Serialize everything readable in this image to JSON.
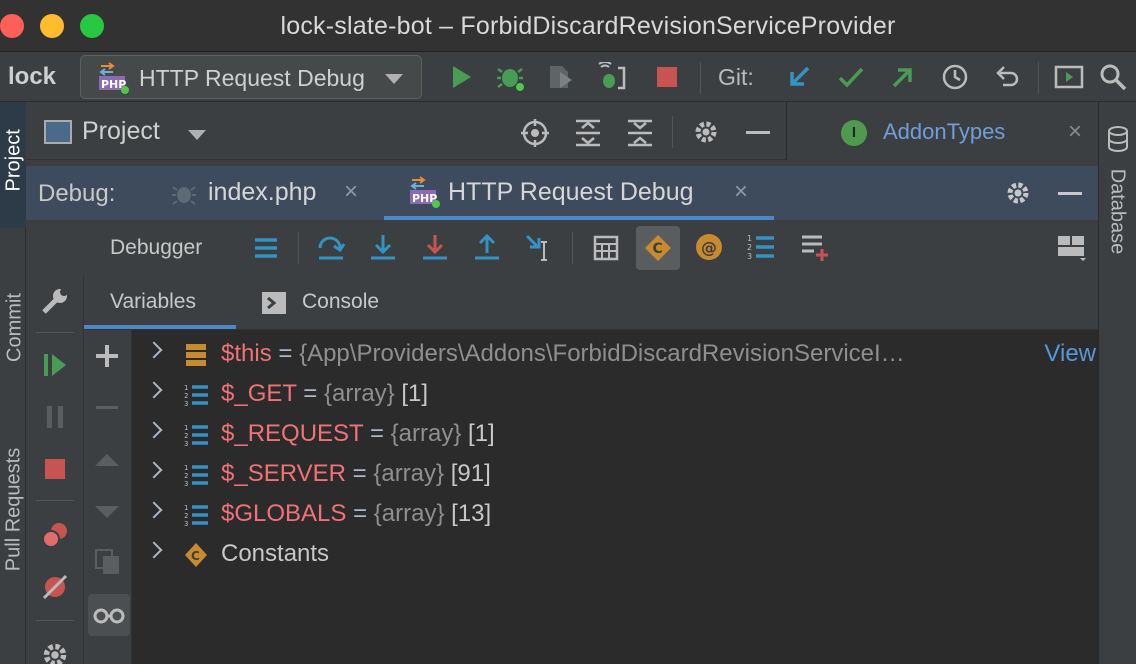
{
  "window": {
    "title": "lock-slate-bot – ForbidDiscardRevisionServiceProvider"
  },
  "toolbar": {
    "project_short": "lock",
    "run_config": "HTTP Request Debug",
    "git_label": "Git:"
  },
  "left_stripe": {
    "project": "Project",
    "commit": "Commit",
    "pull_requests": "Pull Requests"
  },
  "right_stripe": {
    "database": "Database"
  },
  "project_panel": {
    "label": "Project"
  },
  "editor_tab": {
    "badge": "I",
    "label": "AddonTypes",
    "close": "×"
  },
  "debug": {
    "label": "Debug:",
    "tabs": [
      {
        "label": "index.php",
        "close": "×"
      },
      {
        "label": "HTTP Request Debug",
        "close": "×"
      }
    ],
    "debugger_label": "Debugger",
    "subtabs": {
      "variables": "Variables",
      "console": "Console"
    }
  },
  "variables": [
    {
      "name": "$this",
      "eq": " = ",
      "type": "{App\\Providers\\Addons\\ForbidDiscardRevisionServiceI…",
      "count": "",
      "link": "View",
      "icon": "object-icon"
    },
    {
      "name": "$_GET",
      "eq": " = ",
      "type": "{array}",
      "count": " [1]",
      "icon": "array-icon"
    },
    {
      "name": "$_REQUEST",
      "eq": " = ",
      "type": "{array}",
      "count": " [1]",
      "icon": "array-icon"
    },
    {
      "name": "$_SERVER",
      "eq": " = ",
      "type": "{array}",
      "count": " [91]",
      "icon": "array-icon"
    },
    {
      "name": "$GLOBALS",
      "eq": " = ",
      "type": "{array}",
      "count": " [13]",
      "icon": "array-icon"
    },
    {
      "name": "Constants",
      "icon": "constants-icon"
    }
  ],
  "colors": {
    "bg": "#3c3f41",
    "tree_bg": "#2b2b2b",
    "var_name": "#f07277",
    "accent": "#4a88c7",
    "run_green": "#499c54",
    "stop_red": "#c75450"
  }
}
